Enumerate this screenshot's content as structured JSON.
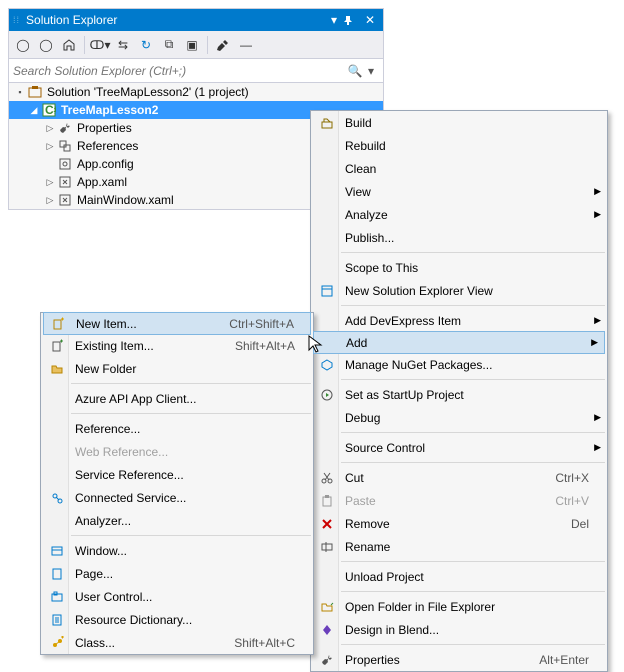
{
  "panel": {
    "title": "Solution Explorer",
    "searchPlaceholder": "Search Solution Explorer (Ctrl+;)",
    "tree": {
      "solution": "Solution 'TreeMapLesson2' (1 project)",
      "project": "TreeMapLesson2",
      "items": [
        "Properties",
        "References",
        "App.config",
        "App.xaml",
        "MainWindow.xaml"
      ]
    }
  },
  "ctxMenu": [
    {
      "label": "Build",
      "icon": "build"
    },
    {
      "label": "Rebuild"
    },
    {
      "label": "Clean"
    },
    {
      "label": "View",
      "sub": true
    },
    {
      "label": "Analyze",
      "sub": true
    },
    {
      "label": "Publish..."
    },
    {
      "sep": true
    },
    {
      "label": "Scope to This"
    },
    {
      "label": "New Solution Explorer View",
      "icon": "newview"
    },
    {
      "sep": true
    },
    {
      "label": "Add DevExpress Item",
      "sub": true
    },
    {
      "label": "Add",
      "sub": true,
      "hl": true
    },
    {
      "label": "Manage NuGet Packages...",
      "icon": "nuget"
    },
    {
      "sep": true
    },
    {
      "label": "Set as StartUp Project",
      "icon": "startup"
    },
    {
      "label": "Debug",
      "sub": true
    },
    {
      "sep": true
    },
    {
      "label": "Source Control",
      "sub": true
    },
    {
      "sep": true
    },
    {
      "label": "Cut",
      "icon": "cut",
      "shortcut": "Ctrl+X"
    },
    {
      "label": "Paste",
      "icon": "paste",
      "shortcut": "Ctrl+V",
      "dis": true
    },
    {
      "label": "Remove",
      "icon": "remove",
      "shortcut": "Del"
    },
    {
      "label": "Rename",
      "icon": "rename"
    },
    {
      "sep": true
    },
    {
      "label": "Unload Project"
    },
    {
      "sep": true
    },
    {
      "label": "Open Folder in File Explorer",
      "icon": "openfolder"
    },
    {
      "label": "Design in Blend...",
      "icon": "blend"
    },
    {
      "sep": true
    },
    {
      "label": "Properties",
      "icon": "props",
      "shortcut": "Alt+Enter"
    }
  ],
  "subMenu": [
    {
      "label": "New Item...",
      "icon": "newitem",
      "shortcut": "Ctrl+Shift+A",
      "hl": true
    },
    {
      "label": "Existing Item...",
      "icon": "existitem",
      "shortcut": "Shift+Alt+A"
    },
    {
      "label": "New Folder",
      "icon": "newfolder"
    },
    {
      "sep": true
    },
    {
      "label": "Azure API App Client..."
    },
    {
      "sep": true
    },
    {
      "label": "Reference..."
    },
    {
      "label": "Web Reference...",
      "dis": true
    },
    {
      "label": "Service Reference..."
    },
    {
      "label": "Connected Service...",
      "icon": "connected"
    },
    {
      "label": "Analyzer..."
    },
    {
      "sep": true
    },
    {
      "label": "Window...",
      "icon": "window"
    },
    {
      "label": "Page...",
      "icon": "page"
    },
    {
      "label": "User Control...",
      "icon": "usercontrol"
    },
    {
      "label": "Resource Dictionary...",
      "icon": "resdict"
    },
    {
      "label": "Class...",
      "icon": "class",
      "shortcut": "Shift+Alt+C"
    }
  ]
}
